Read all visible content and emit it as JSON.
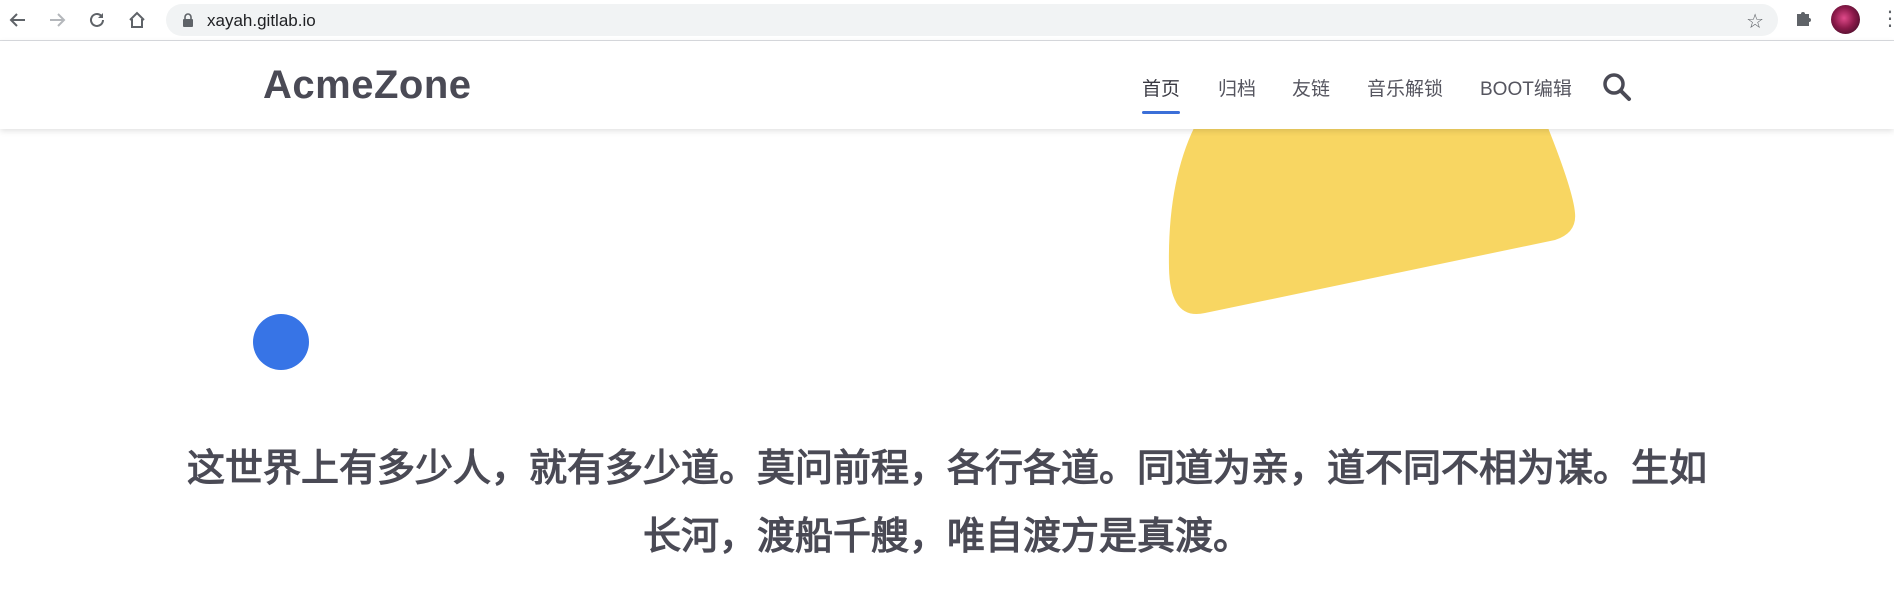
{
  "browser": {
    "url": "xayah.gitlab.io",
    "back_icon": "arrow-left-icon",
    "forward_icon": "arrow-right-icon",
    "reload_icon": "reload-icon",
    "home_icon": "home-icon",
    "bookmark_icon": "star-icon",
    "extensions_icon": "puzzle-icon",
    "menu_icon": "kebab-icon"
  },
  "site": {
    "logo": "AcmeZone",
    "nav": [
      {
        "label": "首页",
        "active": true
      },
      {
        "label": "归档",
        "active": false
      },
      {
        "label": "友链",
        "active": false
      },
      {
        "label": "音乐解锁",
        "active": false
      },
      {
        "label": "BOOT编辑",
        "active": false
      }
    ],
    "search_icon": "search-icon",
    "accent_color": "#3b6fd8"
  },
  "hero": {
    "quote_line1": "这世界上有多少人，就有多少道。莫问前程，各行各道。同道为亲，道不同不相为谋。生如",
    "quote_line2": "长河，渡船千艘，唯自渡方是真渡。",
    "shape_colors": {
      "yellow": "#f8d662",
      "blue": "#3774e6"
    }
  }
}
